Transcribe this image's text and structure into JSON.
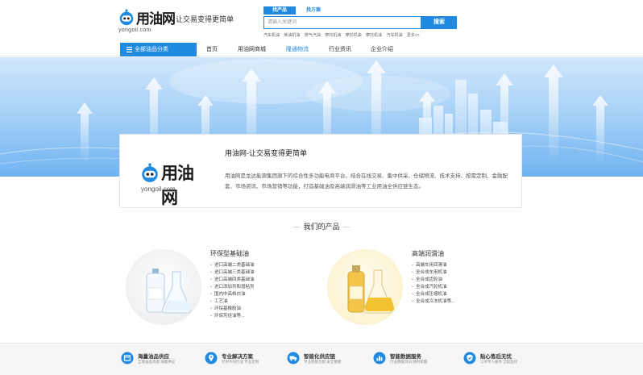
{
  "header": {
    "brand": "用油网",
    "domain": "yongoil.com",
    "slogan": "让交易变得更简单"
  },
  "search": {
    "tab_products": "找产品",
    "tab_solutions": "找方案",
    "placeholder": "请输入关键词",
    "button": "搜索",
    "hotwords": [
      "汽车机油",
      "柴油机油",
      "燃气汽油",
      "摩托机油",
      "摩托机油",
      "摩托机油",
      "汽车机油",
      "更多>>"
    ]
  },
  "nav": {
    "category_button": "全部油品分类",
    "items": [
      "首页",
      "用油网商城",
      "隆通物流",
      "行业资讯",
      "企业介绍"
    ],
    "active_index": 2
  },
  "intro": {
    "brand": "用油网",
    "domain": "yongoil.com",
    "title": "用油网-让交易变得更简单",
    "description": "用油网是龙达能源集团旗下的综合性多功能电商平台。结合在线交易、集中供采、仓储物流、技术支持、按需定制、金融配套、市场资讯、市场营销等功能，打造基础油及高端润滑油等工业用油全供应链生态。"
  },
  "products": {
    "title": "我们的产品",
    "items": [
      {
        "title": "环保型基础油",
        "list": [
          "进口高端二类基础油",
          "进口高端三类基础油",
          "进口高端四类基础油",
          "进口添加剂和增粘剂",
          "国内中高档白油",
          "工艺油",
          "环烷基橡胶油",
          "环保芳烃油等..."
        ]
      },
      {
        "title": "高端润滑油",
        "list": [
          "高端车用润滑油",
          "全合成车用机油",
          "全合成齿轮油",
          "全合成汽轮机油",
          "全合成压缩机油",
          "全合成冷冻机油等..."
        ]
      }
    ]
  },
  "services": [
    {
      "title": "海量油品供应",
      "sub": "全球油品资源 海量供应",
      "icon": "box-icon"
    },
    {
      "title": "专业解决方案",
      "sub": "针对不同行业 专业定制",
      "icon": "location-icon"
    },
    {
      "title": "智能化供应链",
      "sub": "专业智能仓配 安全便捷",
      "icon": "truck-icon"
    },
    {
      "title": "智能数据服务",
      "sub": "行业数据资讯 随时掌握",
      "icon": "chart-icon"
    },
    {
      "title": "贴心售后无忧",
      "sub": "订单专人服务 全程监控",
      "icon": "shield-icon"
    }
  ],
  "colors": {
    "primary": "#1f8ae0",
    "banner_light": "#cfe6fb",
    "banner_dark": "#70b3f0"
  }
}
